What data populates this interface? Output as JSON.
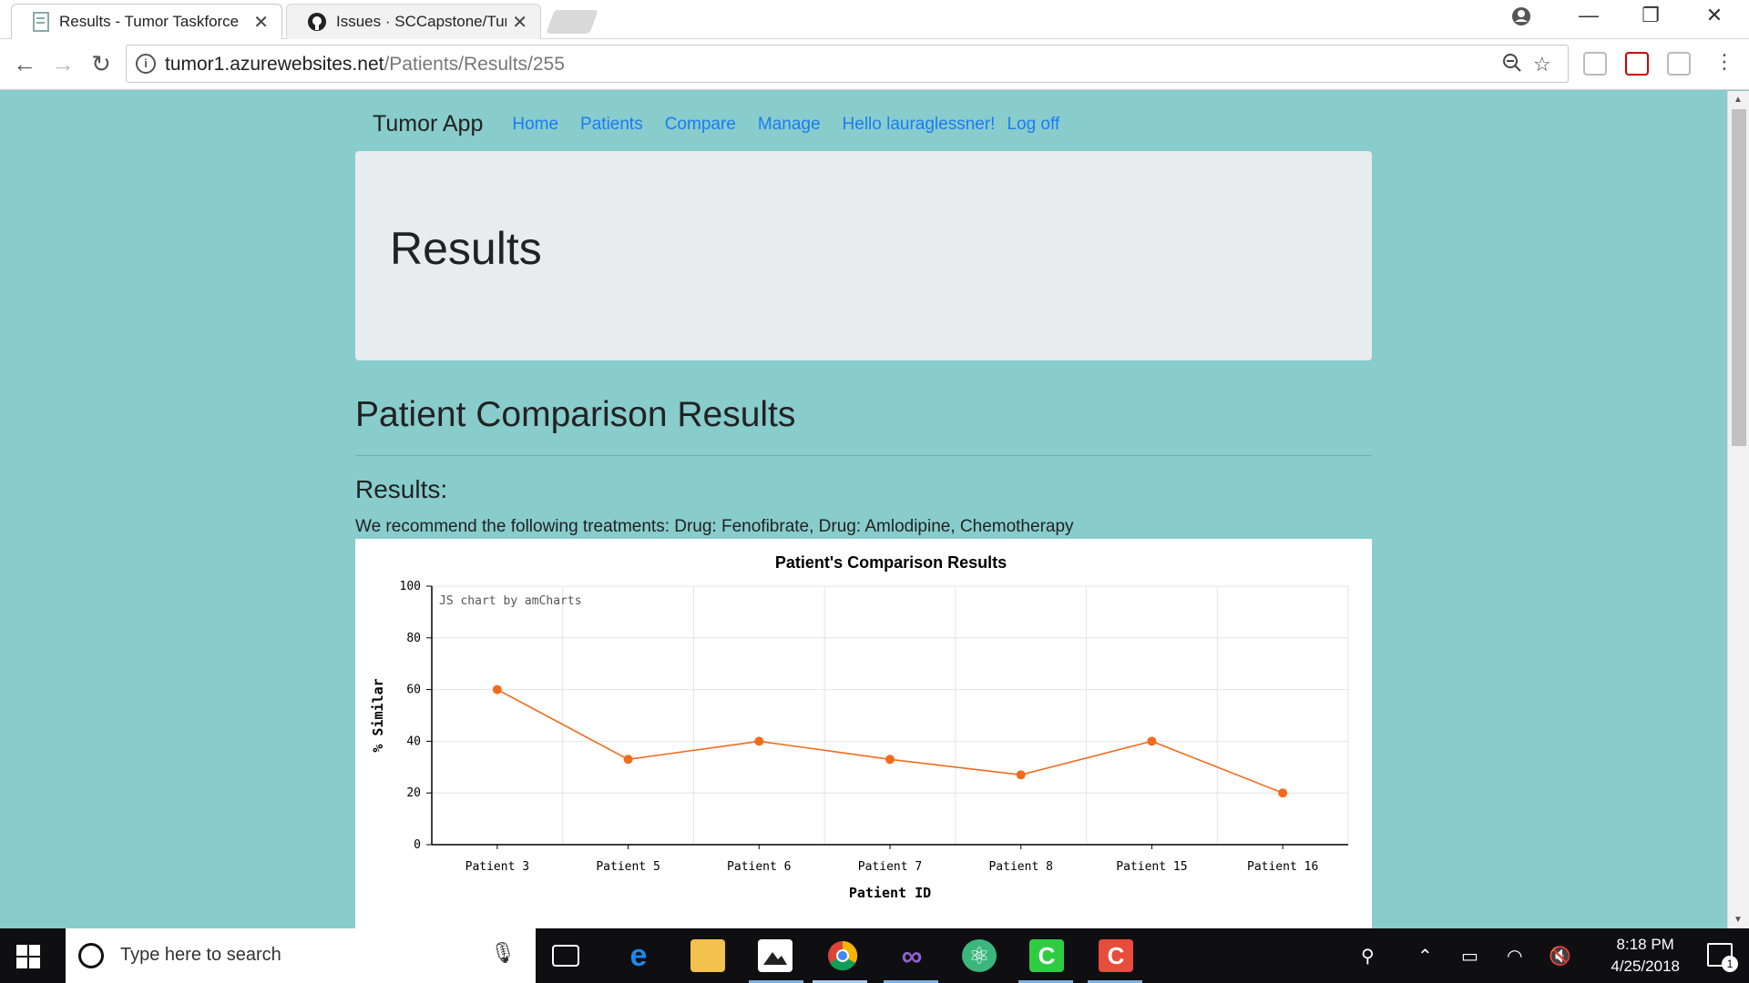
{
  "browser": {
    "tabs": [
      {
        "title": "Results - Tumor Taskforce",
        "active": true
      },
      {
        "title": "Issues · SCCapstone/Tumor",
        "active": false
      }
    ],
    "url_host": "tumor1.azurewebsites.net",
    "url_path": "/Patients/Results/255",
    "window_controls": {
      "minimize": "—",
      "restore": "❐",
      "close": "✕"
    }
  },
  "nav": {
    "brand": "Tumor App",
    "links": [
      "Home",
      "Patients",
      "Compare",
      "Manage"
    ],
    "greeting": "Hello lauraglessner!",
    "logoff": "Log off"
  },
  "page": {
    "jumbotron_title": "Results",
    "heading": "Patient Comparison Results",
    "subheading": "Results:",
    "recommendation": "We recommend the following treatments: Drug: Fenofibrate, Drug: Amlodipine, Chemotherapy"
  },
  "chart_data": {
    "type": "line",
    "title": "Patient's Comparison Results",
    "credit": "JS chart by amCharts",
    "xlabel": "Patient ID",
    "ylabel": "% Similar",
    "categories": [
      "Patient 3",
      "Patient 5",
      "Patient 6",
      "Patient 7",
      "Patient 8",
      "Patient 15",
      "Patient 16"
    ],
    "series": [
      {
        "values": [
          60,
          33,
          40,
          33,
          27,
          40,
          20
        ],
        "color": "#f26b1d"
      }
    ],
    "ylim": [
      0,
      100
    ],
    "yticks": [
      0,
      20,
      40,
      60,
      80,
      100
    ],
    "grid": true
  },
  "taskbar": {
    "search_placeholder": "Type here to search",
    "time": "8:18 PM",
    "date": "4/25/2018",
    "notification_count": "1"
  }
}
